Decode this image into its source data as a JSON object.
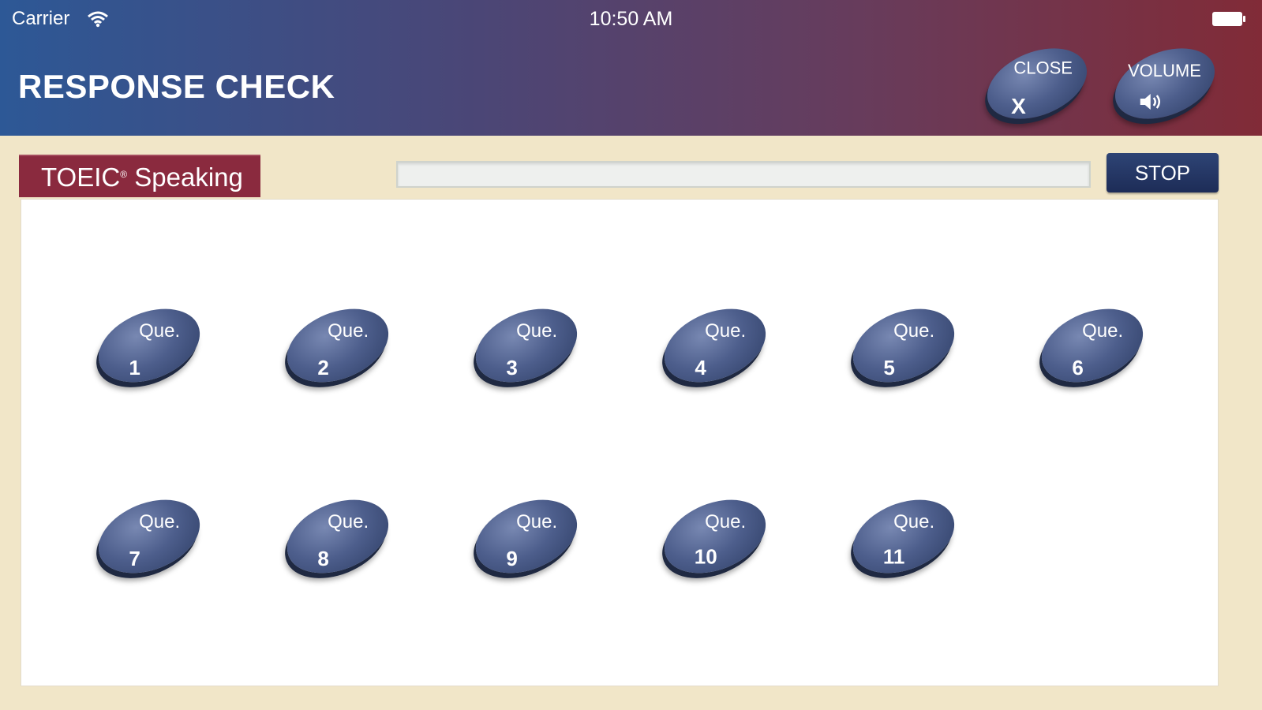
{
  "status_bar": {
    "carrier": "Carrier",
    "time": "10:50 AM",
    "wifi_icon": "wifi-icon",
    "battery_icon": "battery-icon"
  },
  "header": {
    "title": "RESPONSE CHECK",
    "close_button": {
      "label": "CLOSE",
      "symbol": "X"
    },
    "volume_button": {
      "label": "VOLUME",
      "icon": "speaker-icon"
    }
  },
  "toolbar": {
    "tab_label": "TOEIC",
    "tab_label_mark": "®",
    "tab_label_suffix": "Speaking",
    "progress": 0,
    "stop_label": "STOP"
  },
  "questions": {
    "prefix": "Que.",
    "items": [
      {
        "number": "1"
      },
      {
        "number": "2"
      },
      {
        "number": "3"
      },
      {
        "number": "4"
      },
      {
        "number": "5"
      },
      {
        "number": "6"
      },
      {
        "number": "7"
      },
      {
        "number": "8"
      },
      {
        "number": "9"
      },
      {
        "number": "10"
      },
      {
        "number": "11"
      }
    ]
  },
  "colors": {
    "header_left": "#2d5896",
    "header_right": "#812b37",
    "tab": "#8a2a3e",
    "stop": "#1d2c57",
    "page_bg": "#f1e6c8"
  }
}
